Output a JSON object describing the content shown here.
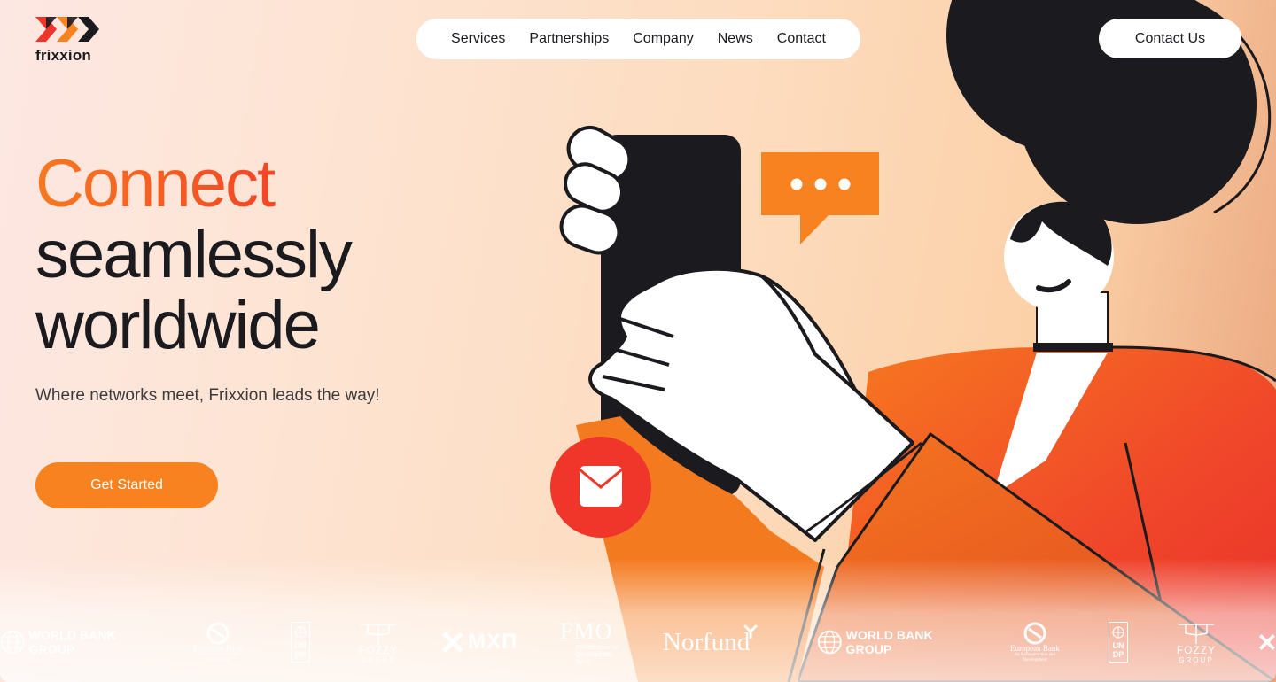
{
  "brand": {
    "name": "frixxion",
    "colors": {
      "orange": "#F7821F",
      "red": "#F0352A",
      "dark": "#1B1B1F"
    }
  },
  "nav": {
    "items": [
      {
        "label": "Services"
      },
      {
        "label": "Partnerships"
      },
      {
        "label": "Company"
      },
      {
        "label": "News"
      },
      {
        "label": "Contact"
      }
    ],
    "contact_button": "Contact Us"
  },
  "hero": {
    "line1": "Connect",
    "line2": "seamlessly",
    "line3": "worldwide",
    "subtitle": "Where networks meet, Frixxion leads the way!",
    "cta": "Get Started"
  },
  "illustration": {
    "icons": [
      "phone-icon",
      "chat-bubble-icon",
      "mail-icon"
    ]
  },
  "partners": {
    "world_bank": "WORLD BANK GROUP",
    "ebrd_line1": "European Bank",
    "ebrd_line2": "for Reconstruction and Development",
    "undp": "UN DP",
    "fozzy_name": "FOZZY",
    "fozzy_sub": "GROUP",
    "mhp": "МХП",
    "fmo": "FMO",
    "fmo_sub1": "Entrepreneurial",
    "fmo_sub2": "Development",
    "fmo_sub3": "Bank",
    "norfund": "Norfund"
  }
}
